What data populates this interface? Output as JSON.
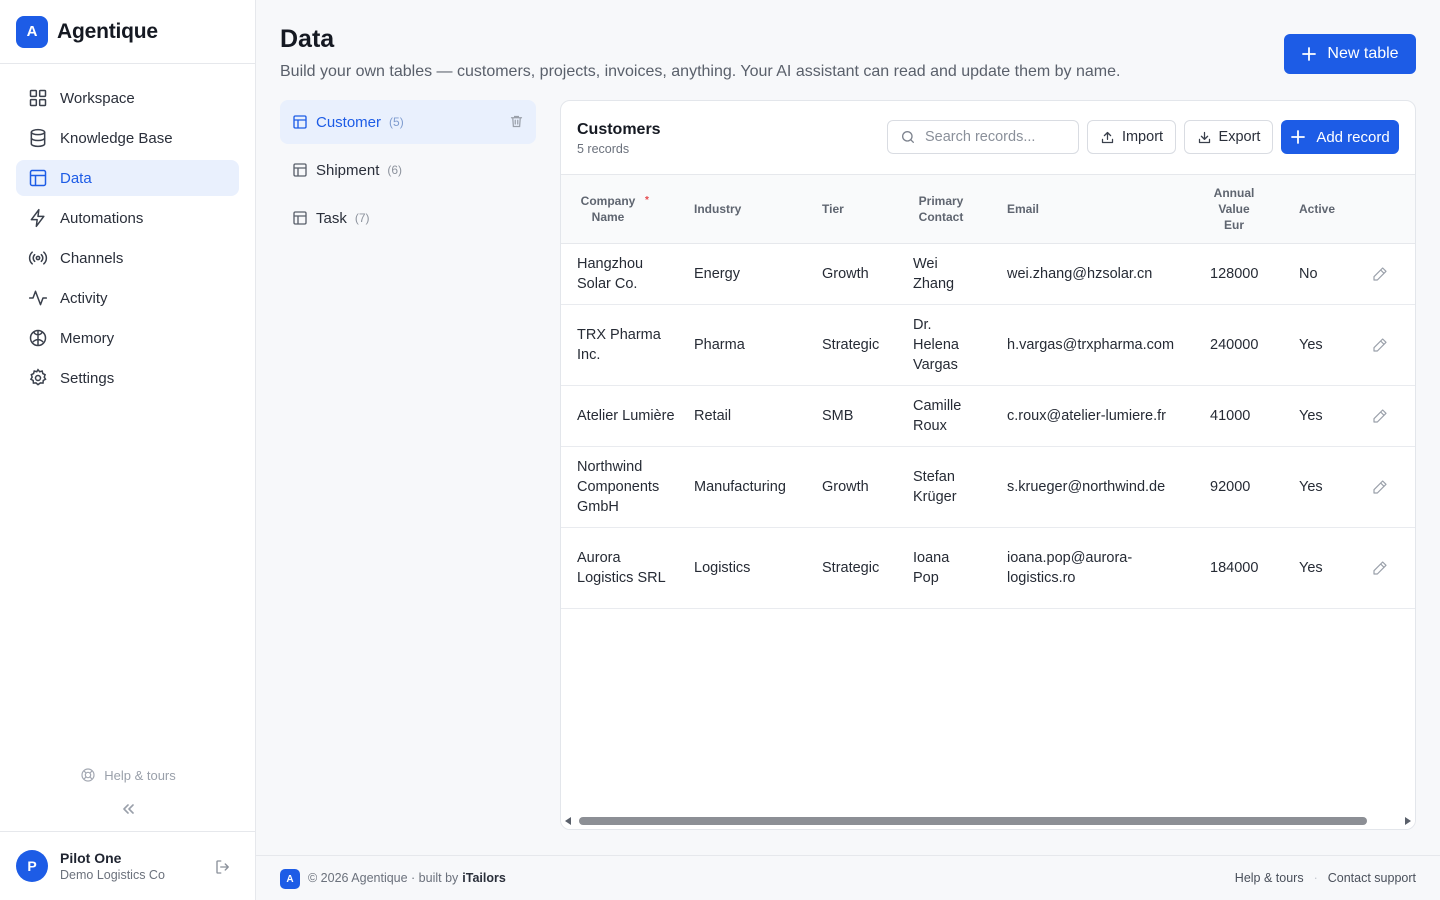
{
  "brand": {
    "logo_letter": "A",
    "name": "Agentique"
  },
  "nav": {
    "items": [
      {
        "label": "Workspace",
        "icon": "grid-icon"
      },
      {
        "label": "Knowledge Base",
        "icon": "database-icon"
      },
      {
        "label": "Data",
        "icon": "table-icon",
        "active": true
      },
      {
        "label": "Automations",
        "icon": "lightning-icon"
      },
      {
        "label": "Channels",
        "icon": "broadcast-icon"
      },
      {
        "label": "Activity",
        "icon": "activity-icon"
      },
      {
        "label": "Memory",
        "icon": "brain-icon"
      },
      {
        "label": "Settings",
        "icon": "gear-icon"
      }
    ],
    "help_label": "Help & tours"
  },
  "user": {
    "initial": "P",
    "name": "Pilot One",
    "org": "Demo Logistics Co"
  },
  "page": {
    "title": "Data",
    "subtitle": "Build your own tables — customers, projects, invoices, anything. Your AI assistant can read and update them by name.",
    "new_table_label": "New table"
  },
  "tables": [
    {
      "name": "Customer",
      "count": "(5)",
      "active": true
    },
    {
      "name": "Shipment",
      "count": "(6)"
    },
    {
      "name": "Task",
      "count": "(7)"
    }
  ],
  "card": {
    "title": "Customers",
    "record_count": "5 records",
    "search_placeholder": "Search records...",
    "import_label": "Import",
    "export_label": "Export",
    "add_label": "Add record"
  },
  "columns": [
    "Company Name",
    "Industry",
    "Tier",
    "Primary Contact",
    "Email",
    "Annual Value Eur",
    "Active"
  ],
  "rows": [
    {
      "company": "Hangzhou Solar Co.",
      "industry": "Energy",
      "tier": "Growth",
      "contact": "Wei Zhang",
      "email": "wei.zhang@hzsolar.cn",
      "value": "128000",
      "active": "No"
    },
    {
      "company": "TRX Pharma Inc.",
      "industry": "Pharma",
      "tier": "Strategic",
      "contact": "Dr. Helena Vargas",
      "email": "h.vargas@trxpharma.com",
      "value": "240000",
      "active": "Yes"
    },
    {
      "company": "Atelier Lumière",
      "industry": "Retail",
      "tier": "SMB",
      "contact": "Camille Roux",
      "email": "c.roux@atelier-lumiere.fr",
      "value": "41000",
      "active": "Yes"
    },
    {
      "company": "Northwind Components GmbH",
      "industry": "Manufacturing",
      "tier": "Growth",
      "contact": "Stefan Krüger",
      "email": "s.krueger@northwind.de",
      "value": "92000",
      "active": "Yes"
    },
    {
      "company": "Aurora Logistics SRL",
      "industry": "Logistics",
      "tier": "Strategic",
      "contact": "Ioana Pop",
      "email": "ioana.pop@aurora-logistics.ro",
      "value": "184000",
      "active": "Yes"
    }
  ],
  "footer": {
    "logo_letter": "A",
    "copyright": "© 2026 Agentique · built by",
    "built_by": "iTailors",
    "help_link": "Help & tours",
    "support_link": "Contact support"
  },
  "colors": {
    "accent": "#1d5ce6",
    "active_bg": "#e9f0fd",
    "required": "#e5484d"
  }
}
